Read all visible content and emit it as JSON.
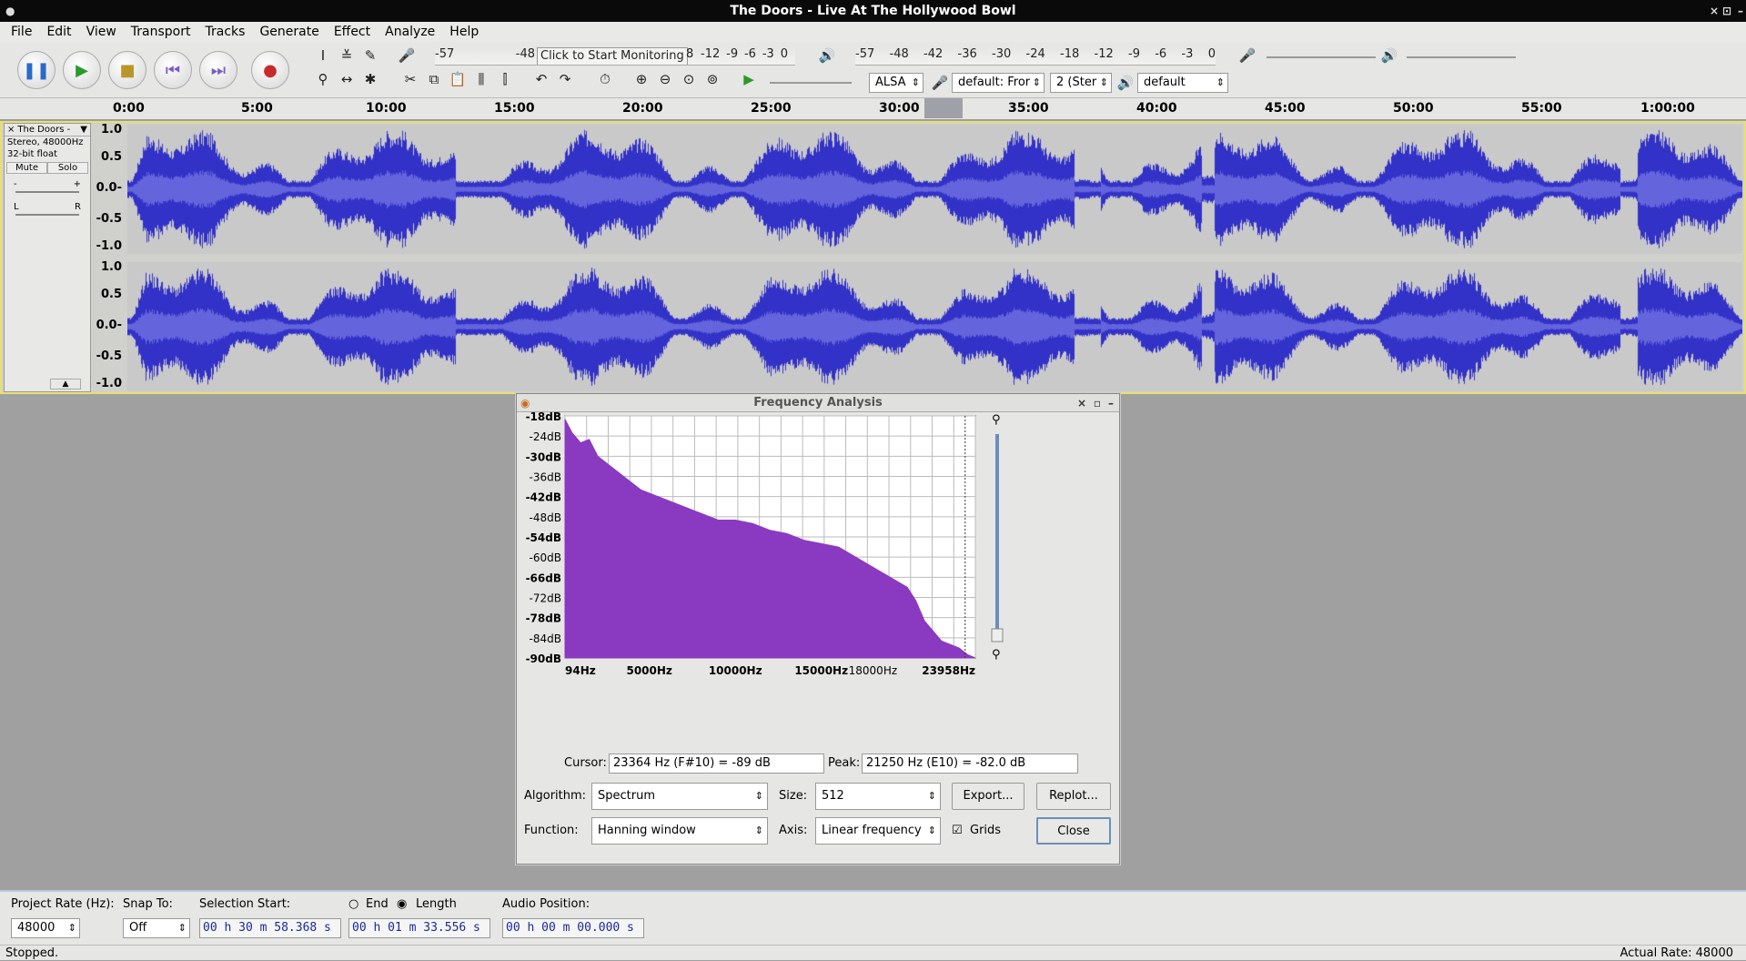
{
  "window": {
    "title": "The Doors - Live At The Hollywood Bowl"
  },
  "menu": [
    "File",
    "Edit",
    "View",
    "Transport",
    "Tracks",
    "Generate",
    "Effect",
    "Analyze",
    "Help"
  ],
  "toolbar": {
    "record_meter_ticks": [
      "-57",
      "-48",
      "",
      "",
      "",
      "-12",
      "-9",
      "-6",
      "-3",
      "0"
    ],
    "monitor_label": "Click to Start Monitoring",
    "monitor_trailing": "8",
    "play_meter_ticks": [
      "-57",
      "-48",
      "-42",
      "-36",
      "-30",
      "-24",
      "-18",
      "-12",
      "-9",
      "-6",
      "-3",
      "0"
    ],
    "host": "ALSA",
    "rec_device": "default: Fror",
    "channels": "2 (Ster",
    "play_device": "default"
  },
  "ruler": {
    "labels": [
      "0:00",
      "5:00",
      "10:00",
      "15:00",
      "20:00",
      "25:00",
      "30:00",
      "35:00",
      "40:00",
      "45:00",
      "50:00",
      "55:00",
      "1:00:00"
    ]
  },
  "track": {
    "name": "The Doors -",
    "info1": "Stereo, 48000Hz",
    "info2": "32-bit float",
    "mute": "Mute",
    "solo": "Solo",
    "gain_minus": "-",
    "gain_plus": "+",
    "pan_left": "L",
    "pan_right": "R",
    "scale": [
      "1.0",
      "0.5",
      "0.0-",
      "-0.5",
      "-1.0"
    ],
    "wave_color": "#3232c8",
    "rms_color": "#6464dc"
  },
  "dialog": {
    "title": "Frequency Analysis",
    "cursor_label": "Cursor:",
    "cursor_value": "23364 Hz (F#10) = -89 dB",
    "peak_label": "Peak:",
    "peak_value": "21250 Hz (E10) = -82.0 dB",
    "algorithm_label": "Algorithm:",
    "algorithm": "Spectrum",
    "size_label": "Size:",
    "size": "512",
    "export": "Export...",
    "replot": "Replot...",
    "function_label": "Function:",
    "function": "Hanning window",
    "axis_label": "Axis:",
    "axis": "Linear frequency",
    "grids_label": "Grids",
    "grids_checked": true,
    "close": "Close"
  },
  "chart_data": {
    "type": "area",
    "x_unit": "Hz",
    "y_unit": "dB",
    "xlim": [
      94,
      23958
    ],
    "ylim": [
      -90,
      -18
    ],
    "grid": true,
    "fill_color": "#8a3ac0",
    "x_tick_labels": [
      "94Hz",
      "5000Hz",
      "10000Hz",
      "15000Hz",
      "18000Hz",
      "23958Hz"
    ],
    "y_tick_labels": [
      "-18dB",
      "-24dB",
      "-30dB",
      "-36dB",
      "-42dB",
      "-48dB",
      "-54dB",
      "-60dB",
      "-66dB",
      "-72dB",
      "-78dB",
      "-84dB",
      "-90dB"
    ],
    "series": [
      {
        "x": [
          94,
          500,
          1000,
          1500,
          2000,
          2500,
          3000,
          3500,
          4000,
          4500,
          5000,
          6000,
          7000,
          8000,
          9000,
          10000,
          11000,
          12000,
          13000,
          14000,
          15000,
          16000,
          17000,
          18000,
          19000,
          20000,
          20500,
          21000,
          21500,
          22000,
          22500,
          23000,
          23500,
          23958
        ],
        "y": [
          -19,
          -23,
          -26,
          -25,
          -30,
          -32,
          -34,
          -36,
          -38,
          -40,
          -41,
          -43,
          -45,
          -47,
          -49,
          -49,
          -50,
          -52,
          -53,
          -55,
          -56,
          -57,
          -60,
          -63,
          -66,
          -69,
          -73,
          -79,
          -82,
          -85,
          -86,
          -87,
          -89,
          -90
        ]
      }
    ]
  },
  "bottom": {
    "project_rate_label": "Project Rate (Hz):",
    "project_rate": "48000",
    "snap_label": "Snap To:",
    "snap": "Off",
    "sel_start_label": "Selection Start:",
    "end_label": "End",
    "length_label": "Length",
    "sel_start": "00 h 30 m 58.368 s",
    "sel_length": "00 h 01 m 33.556 s",
    "audio_pos_label": "Audio Position:",
    "audio_pos": "00 h 00 m 00.000 s"
  },
  "status": {
    "left": "Stopped.",
    "right": "Actual Rate: 48000"
  }
}
